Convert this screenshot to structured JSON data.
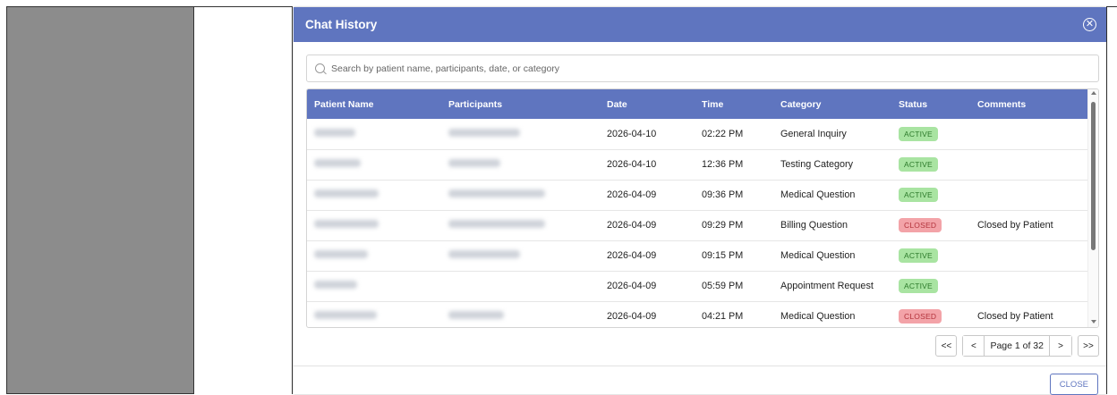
{
  "modal": {
    "title": "Chat History",
    "close_icon": "close-circle-icon",
    "close_button": "CLOSE"
  },
  "search": {
    "placeholder": "Search by patient name, participants, date, or category"
  },
  "table": {
    "columns": [
      "Patient Name",
      "Participants",
      "Date",
      "Time",
      "Category",
      "Status",
      "Comments"
    ],
    "rows": [
      {
        "date": "2026-04-10",
        "time": "02:22 PM",
        "category": "General Inquiry",
        "status": "ACTIVE",
        "comments": ""
      },
      {
        "date": "2026-04-10",
        "time": "12:36 PM",
        "category": "Testing Category",
        "status": "ACTIVE",
        "comments": ""
      },
      {
        "date": "2026-04-09",
        "time": "09:36 PM",
        "category": "Medical Question",
        "status": "ACTIVE",
        "comments": ""
      },
      {
        "date": "2026-04-09",
        "time": "09:29 PM",
        "category": "Billing Question",
        "status": "CLOSED",
        "comments": "Closed by Patient"
      },
      {
        "date": "2026-04-09",
        "time": "09:15 PM",
        "category": "Medical Question",
        "status": "ACTIVE",
        "comments": ""
      },
      {
        "date": "2026-04-09",
        "time": "05:59 PM",
        "category": "Appointment Request",
        "status": "ACTIVE",
        "comments": ""
      },
      {
        "date": "2026-04-09",
        "time": "04:21 PM",
        "category": "Medical Question",
        "status": "CLOSED",
        "comments": "Closed by Patient"
      }
    ]
  },
  "pagination": {
    "first": "<<",
    "prev": "<",
    "label": "Page 1 of 32",
    "next": ">",
    "last": ">>"
  },
  "colors": {
    "header": "#5f75bf",
    "active_badge": "#a9e4a2",
    "closed_badge": "#f3a3a8"
  }
}
